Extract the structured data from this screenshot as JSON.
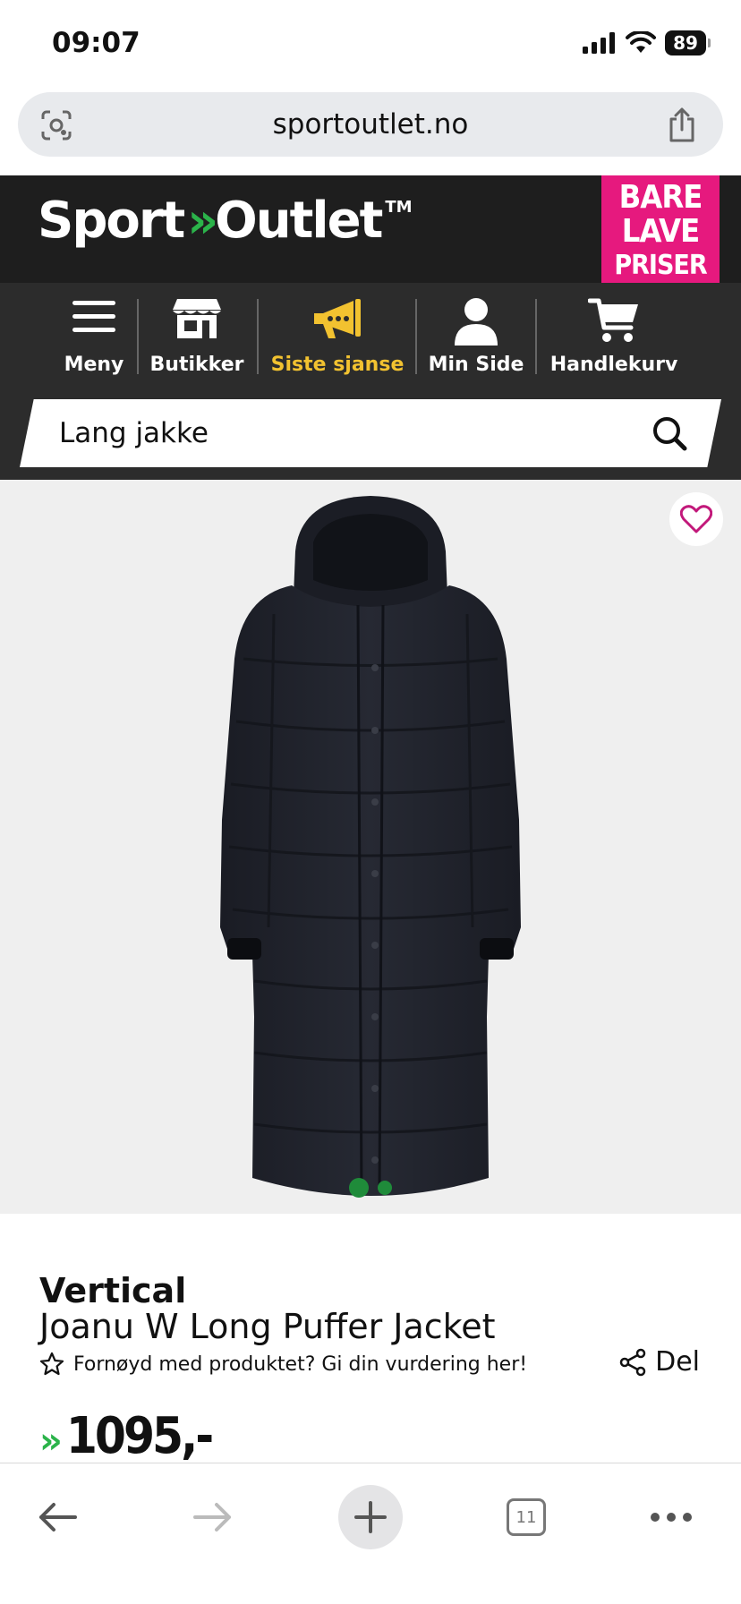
{
  "status_bar": {
    "time": "09:07",
    "battery": "89"
  },
  "browser": {
    "url": "sportoutlet.no",
    "tabs_count": "11"
  },
  "header": {
    "logo_left": "Sport",
    "logo_chevron": "»",
    "logo_right": "Outlet",
    "logo_tm": "TM",
    "promo_lines": [
      "BARE",
      "LAVE",
      "PRISER"
    ],
    "promo_color": "#e6197e"
  },
  "nav": {
    "items": [
      {
        "label": "Meny",
        "icon": "menu-icon"
      },
      {
        "label": "Butikker",
        "icon": "store-icon"
      },
      {
        "label": "Siste sjanse",
        "icon": "megaphone-icon"
      },
      {
        "label": "Min Side",
        "icon": "user-icon"
      },
      {
        "label": "Handlekurv",
        "icon": "cart-icon"
      }
    ],
    "highlight_color": "#f2c230"
  },
  "search": {
    "value": "Lang jakke"
  },
  "product": {
    "brand": "Vertical",
    "name": "Joanu W Long Puffer Jacket",
    "rating_prompt": "Fornøyd med produktet? Gi din vurdering her!",
    "share_label": "Del",
    "price": "1095,-",
    "price_chevron": "»",
    "image_count": 2,
    "active_image": 1
  },
  "colors": {
    "brand_green": "#2bb34a",
    "dot_green": "#1f8b3a"
  }
}
